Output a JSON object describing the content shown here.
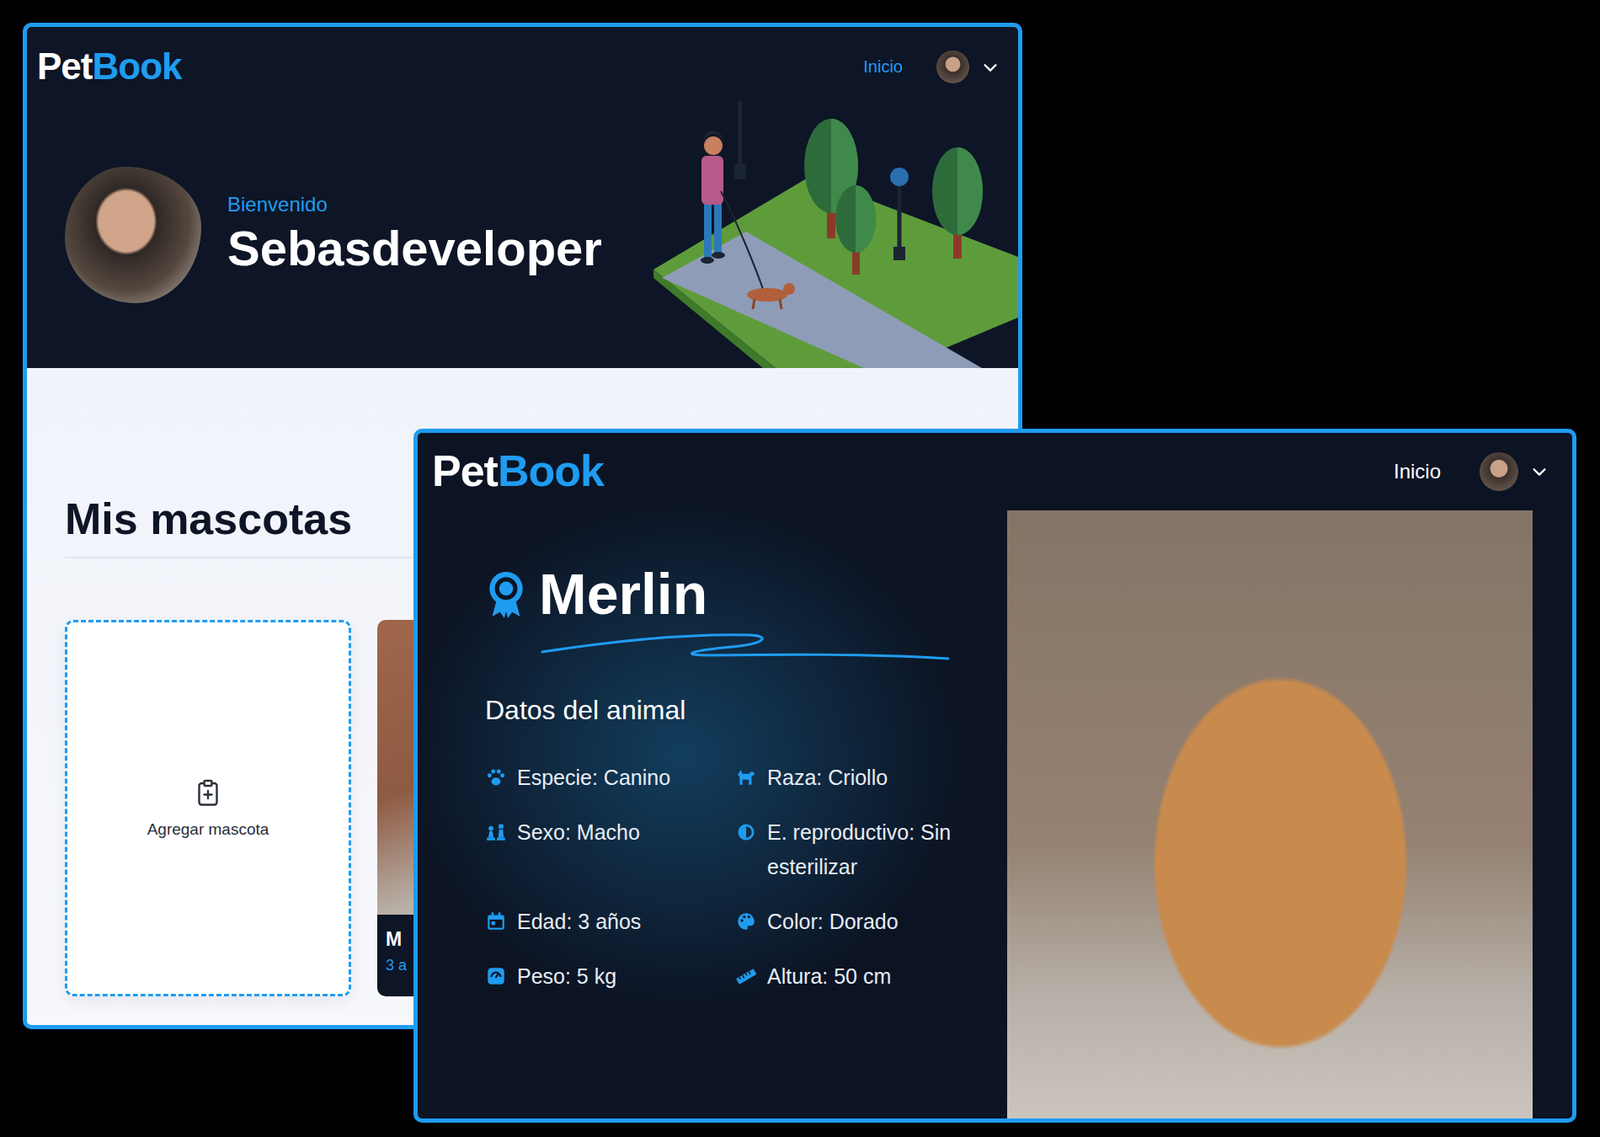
{
  "back_window": {
    "logo": {
      "pet": "Pet",
      "book": "Book"
    },
    "nav": {
      "label": "Inicio",
      "selected": true
    },
    "hero": {
      "greeting": "Bienvenido",
      "username": "Sebasdeveloper"
    },
    "section_title": "Mis mascotas",
    "cards": [
      {
        "kind": "add",
        "label": "Agregar mascota"
      },
      {
        "kind": "pet",
        "name": "M",
        "age": "3 a"
      }
    ]
  },
  "front_window": {
    "logo": {
      "pet": "Pet",
      "book": "Book"
    },
    "nav": {
      "label": "Inicio",
      "selected": false
    },
    "pet_name": "Merlin",
    "section_title": "Datos del animal",
    "fields": [
      "Especie: Canino",
      "Raza: Criollo",
      "Sexo: Macho",
      "E. reproductivo: Sin esterilizar",
      "Edad: 3 años",
      "Color: Dorado",
      "Peso: 5 kg",
      "Altura: 50 cm"
    ]
  }
}
